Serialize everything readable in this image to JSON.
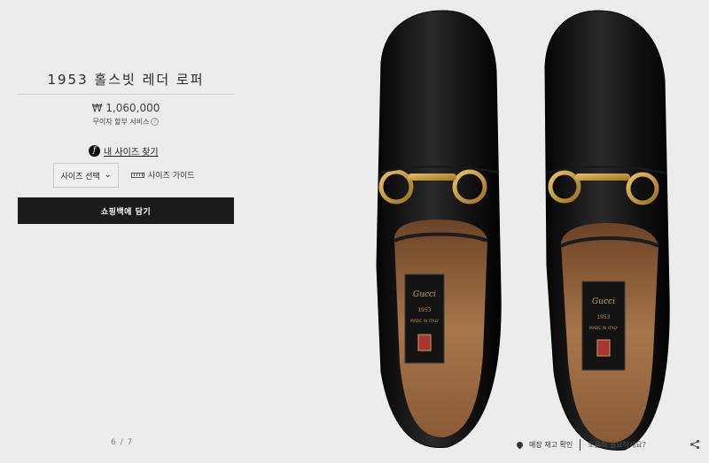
{
  "product": {
    "title": "1953 홀스빗 레더 로퍼",
    "price": "₩ 1,060,000",
    "installment": "무이자 할부 서비스"
  },
  "sizing": {
    "find_size_badge": "f",
    "find_size_label": "내 사이즈 찾기",
    "select_label": "사이즈 선택",
    "guide_label": "사이즈 가이드"
  },
  "cart": {
    "label": "쇼핑백에 담기"
  },
  "gallery": {
    "pager": "6 / 7"
  },
  "footer": {
    "store_stock": "매장 재고 확인",
    "help": "도움이 필요하세요?"
  },
  "insole": {
    "brand": "Gucci",
    "year": "1953",
    "origin": "MADE IN ITALY"
  },
  "colors": {
    "background": "#ececec",
    "button": "#1b1b1b",
    "leather": "#111111",
    "lining": "#9a6a44",
    "buckle": "#c89a3c"
  },
  "icons": [
    "info-icon",
    "ruler-icon",
    "chevron-down-icon",
    "pin-icon",
    "share-icon"
  ]
}
